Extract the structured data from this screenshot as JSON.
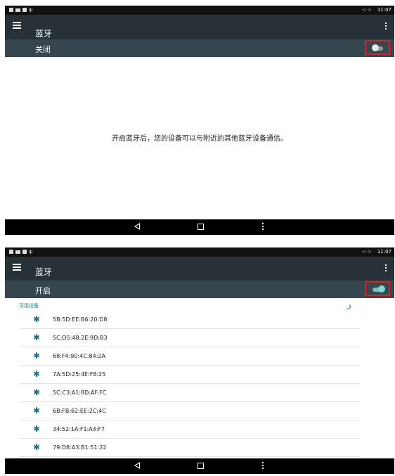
{
  "status_bar": {
    "time": "11:07",
    "sync_indicator": "<·>"
  },
  "screen_off": {
    "app_title": "蓝牙",
    "toggle_label": "关闭",
    "toggle_state": "off",
    "empty_message": "开启蓝牙后，您的设备可以与附近的其他蓝牙设备通信。"
  },
  "screen_on": {
    "app_title": "蓝牙",
    "toggle_label": "开启",
    "toggle_state": "on",
    "section_header": "可用设备",
    "devices": [
      {
        "name": "5B:5D:EE:B6:20:D8"
      },
      {
        "name": "5C:D5:48:2E:9D:B3"
      },
      {
        "name": "68:F4:90:4C:84:2A"
      },
      {
        "name": "7A:5D:25:4E:F8:25"
      },
      {
        "name": "5C:C3:A1:8D:AF:FC"
      },
      {
        "name": "6B:FB:62:EE:2C:4C"
      },
      {
        "name": "34:52:1A:F1:A4:F7"
      },
      {
        "name": "79:D8:A3:B1:51:22"
      }
    ]
  },
  "icons": {
    "menu": "hamburger-menu-icon",
    "overflow": "vertical-dots-icon",
    "bluetooth": "bluetooth-icon",
    "back": "back-triangle-icon",
    "home": "home-square-icon",
    "recents": "menu-dots-icon"
  },
  "colors": {
    "app_bar": "#263238",
    "toggle_bar": "#37474f",
    "accent": "#0a8f86",
    "highlight_box": "#e02020"
  }
}
